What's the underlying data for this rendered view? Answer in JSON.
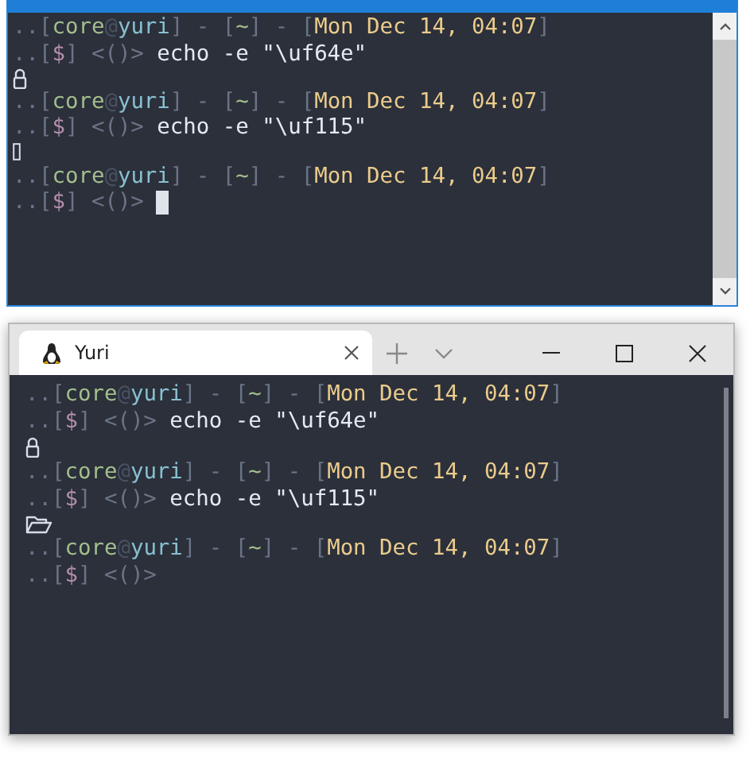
{
  "console_window": {
    "lines": [
      {
        "kind": "prompt",
        "cursor": false,
        "segments": [
          {
            "text": "..[",
            "kind": "dim"
          },
          {
            "text": "core",
            "kind": "green"
          },
          {
            "text": "@",
            "kind": "faint"
          },
          {
            "text": "yuri",
            "kind": "cyan"
          },
          {
            "text": "] - [",
            "kind": "dim"
          },
          {
            "text": "~",
            "kind": "green"
          },
          {
            "text": "] - [",
            "kind": "dim"
          },
          {
            "text": "Mon Dec 14, 04:07",
            "kind": "yellow"
          },
          {
            "text": "]",
            "kind": "dim"
          }
        ]
      },
      {
        "kind": "prompt",
        "cursor": false,
        "segments": [
          {
            "text": "..[",
            "kind": "dim"
          },
          {
            "text": "$",
            "kind": "purple"
          },
          {
            "text": "] <()>",
            "kind": "dim"
          },
          {
            "text": " echo -e \"\\uf64e\"",
            "kind": "plain"
          }
        ]
      },
      {
        "kind": "padlock-output"
      },
      {
        "kind": "prompt",
        "cursor": false,
        "segments": [
          {
            "text": "..[",
            "kind": "dim"
          },
          {
            "text": "core",
            "kind": "green"
          },
          {
            "text": "@",
            "kind": "faint"
          },
          {
            "text": "yuri",
            "kind": "cyan"
          },
          {
            "text": "] - [",
            "kind": "dim"
          },
          {
            "text": "~",
            "kind": "green"
          },
          {
            "text": "] - [",
            "kind": "dim"
          },
          {
            "text": "Mon Dec 14, 04:07",
            "kind": "yellow"
          },
          {
            "text": "]",
            "kind": "dim"
          }
        ]
      },
      {
        "kind": "prompt",
        "cursor": false,
        "segments": [
          {
            "text": "..[",
            "kind": "dim"
          },
          {
            "text": "$",
            "kind": "purple"
          },
          {
            "text": "] <()>",
            "kind": "dim"
          },
          {
            "text": " echo -e \"\\uf115\"",
            "kind": "plain"
          }
        ]
      },
      {
        "kind": "missing-glyph-output"
      },
      {
        "kind": "prompt",
        "cursor": false,
        "segments": [
          {
            "text": "..[",
            "kind": "dim"
          },
          {
            "text": "core",
            "kind": "green"
          },
          {
            "text": "@",
            "kind": "faint"
          },
          {
            "text": "yuri",
            "kind": "cyan"
          },
          {
            "text": "] - [",
            "kind": "dim"
          },
          {
            "text": "~",
            "kind": "green"
          },
          {
            "text": "] - [",
            "kind": "dim"
          },
          {
            "text": "Mon Dec 14, 04:07",
            "kind": "yellow"
          },
          {
            "text": "]",
            "kind": "dim"
          }
        ]
      },
      {
        "kind": "prompt",
        "cursor": true,
        "segments": [
          {
            "text": "..[",
            "kind": "dim"
          },
          {
            "text": "$",
            "kind": "purple"
          },
          {
            "text": "] <()>",
            "kind": "dim"
          }
        ]
      }
    ]
  },
  "terminal_window": {
    "tabs": [
      {
        "label": "Yuri",
        "selected": true
      }
    ],
    "lines": [
      {
        "kind": "prompt",
        "cursor": false,
        "segments": [
          {
            "text": "..[",
            "kind": "dim"
          },
          {
            "text": "core",
            "kind": "green"
          },
          {
            "text": "@",
            "kind": "faint"
          },
          {
            "text": "yuri",
            "kind": "cyan"
          },
          {
            "text": "] - [",
            "kind": "dim"
          },
          {
            "text": "~",
            "kind": "green"
          },
          {
            "text": "] - [",
            "kind": "dim"
          },
          {
            "text": "Mon Dec 14, 04:07",
            "kind": "yellow"
          },
          {
            "text": "]",
            "kind": "dim"
          }
        ]
      },
      {
        "kind": "prompt",
        "cursor": false,
        "segments": [
          {
            "text": "..[",
            "kind": "dim"
          },
          {
            "text": "$",
            "kind": "purple"
          },
          {
            "text": "] <()>",
            "kind": "dim"
          },
          {
            "text": " echo -e \"\\uf64e\"",
            "kind": "plain"
          }
        ]
      },
      {
        "kind": "padlock-output"
      },
      {
        "kind": "prompt",
        "cursor": false,
        "segments": [
          {
            "text": "..[",
            "kind": "dim"
          },
          {
            "text": "core",
            "kind": "green"
          },
          {
            "text": "@",
            "kind": "faint"
          },
          {
            "text": "yuri",
            "kind": "cyan"
          },
          {
            "text": "] - [",
            "kind": "dim"
          },
          {
            "text": "~",
            "kind": "green"
          },
          {
            "text": "] - [",
            "kind": "dim"
          },
          {
            "text": "Mon Dec 14, 04:07",
            "kind": "yellow"
          },
          {
            "text": "]",
            "kind": "dim"
          }
        ]
      },
      {
        "kind": "prompt",
        "cursor": false,
        "segments": [
          {
            "text": "..[",
            "kind": "dim"
          },
          {
            "text": "$",
            "kind": "purple"
          },
          {
            "text": "] <()>",
            "kind": "dim"
          },
          {
            "text": " echo -e \"\\uf115\"",
            "kind": "plain"
          }
        ]
      },
      {
        "kind": "folder-output"
      },
      {
        "kind": "prompt",
        "cursor": false,
        "segments": [
          {
            "text": "..[",
            "kind": "dim"
          },
          {
            "text": "core",
            "kind": "green"
          },
          {
            "text": "@",
            "kind": "faint"
          },
          {
            "text": "yuri",
            "kind": "cyan"
          },
          {
            "text": "] - [",
            "kind": "dim"
          },
          {
            "text": "~",
            "kind": "green"
          },
          {
            "text": "] - [",
            "kind": "dim"
          },
          {
            "text": "Mon Dec 14, 04:07",
            "kind": "yellow"
          },
          {
            "text": "]",
            "kind": "dim"
          }
        ]
      },
      {
        "kind": "prompt",
        "cursor": false,
        "segments": [
          {
            "text": "..[",
            "kind": "dim"
          },
          {
            "text": "$",
            "kind": "purple"
          },
          {
            "text": "] <()>",
            "kind": "dim"
          }
        ]
      }
    ]
  }
}
